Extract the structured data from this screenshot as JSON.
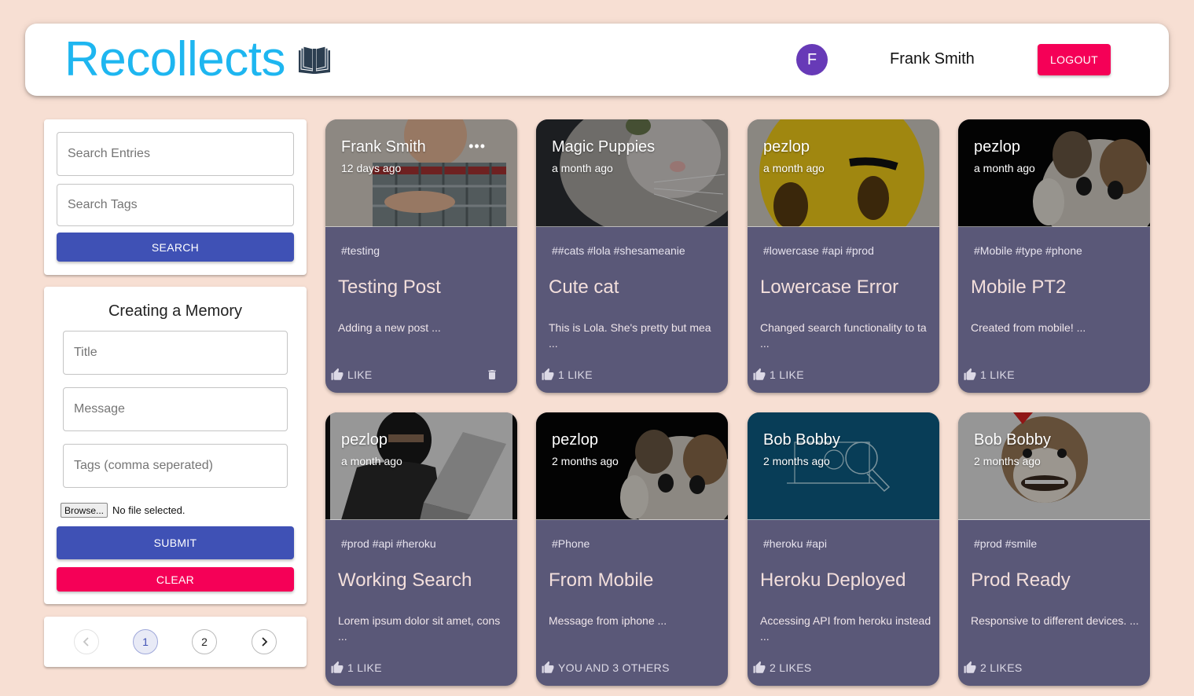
{
  "app": {
    "title": "Recollects",
    "user_initial": "F",
    "user_name": "Frank Smith",
    "logout_label": "LOGOUT"
  },
  "search": {
    "entries_placeholder": "Search Entries",
    "tags_placeholder": "Search Tags",
    "button_label": "SEARCH"
  },
  "form": {
    "heading": "Creating a Memory",
    "title_placeholder": "Title",
    "message_placeholder": "Message",
    "tags_placeholder": "Tags (comma seperated)",
    "browse_label": "Browse...",
    "file_status": "No file selected.",
    "submit_label": "SUBMIT",
    "clear_label": "CLEAR"
  },
  "pagination": {
    "prev_icon": "chevron-left-icon",
    "pages": [
      "1",
      "2"
    ],
    "current": "1",
    "next_icon": "chevron-right-icon"
  },
  "colors": {
    "brand": "#1eb6f0",
    "primary": "#3f51b5",
    "secondary": "#f50057",
    "card_bg": "#5a5878",
    "page_bg": "#f7dfd3"
  },
  "posts": [
    {
      "author": "Frank Smith",
      "time": "12 days ago",
      "tags": "#testing",
      "title": "Testing Post",
      "message": "Adding a new post ...",
      "likes": "LIKE",
      "image": "child-in-plaid-shirt",
      "owner": true
    },
    {
      "author": "Magic Puppies",
      "time": "a month ago",
      "tags": "##cats #lola #shesameanie",
      "title": "Cute cat",
      "message": "This is Lola. She's pretty but mea ...",
      "likes": "1 LIKE",
      "image": "grey-cat-closeup",
      "owner": false
    },
    {
      "author": "pezlop",
      "time": "a month ago",
      "tags": "#lowercase #api #prod",
      "title": "Lowercase Error",
      "message": "Changed search functionality to ta ...",
      "likes": "1 LIKE",
      "image": "yellow-emoji-face",
      "owner": false
    },
    {
      "author": "pezlop",
      "time": "a month ago",
      "tags": "#Mobile #type #phone",
      "title": "Mobile PT2",
      "message": "Created from mobile! ...",
      "likes": "1 LIKE",
      "image": "crying-cat-thumbs-up",
      "owner": false
    },
    {
      "author": "pezlop",
      "time": "a month ago",
      "tags": "#prod #api #heroku",
      "title": "Working Search",
      "message": "Lorem ipsum dolor sit amet, cons ...",
      "likes": "1 LIKE",
      "image": "hacker-with-laptop",
      "owner": false
    },
    {
      "author": "pezlop",
      "time": "2 months ago",
      "tags": "#Phone",
      "title": "From Mobile",
      "message": "Message from iphone ...",
      "likes": "YOU AND 3 OTHERS",
      "image": "crying-cat-thumbs-up",
      "owner": false
    },
    {
      "author": "Bob Bobby",
      "time": "2 months ago",
      "tags": "#heroku #api",
      "title": "Heroku Deployed",
      "message": "Accessing API from heroku instead ...",
      "likes": "2 LIKES",
      "image": "blue-search-gear-illustration",
      "owner": false
    },
    {
      "author": "Bob Bobby",
      "time": "2 months ago",
      "tags": "#prod #smile",
      "title": "Prod Ready",
      "message": "Responsive to different devices. ...",
      "likes": "2 LIKES",
      "image": "smiling-dog-party-hat",
      "owner": false
    }
  ]
}
